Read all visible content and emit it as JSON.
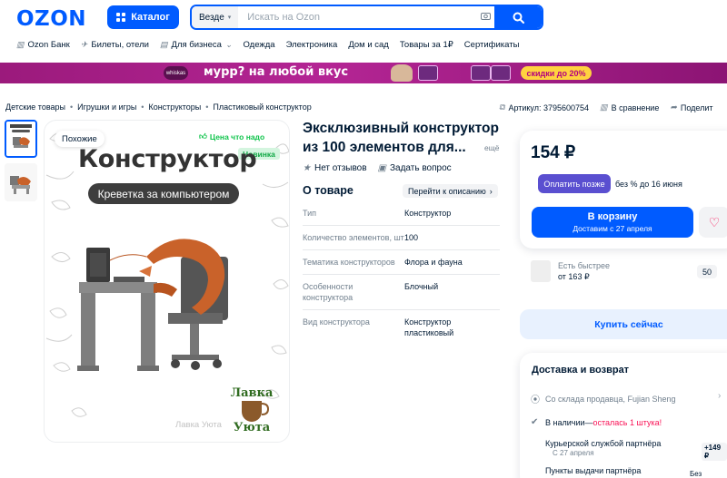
{
  "header": {
    "logo": "OZON",
    "catalog_label": "Каталог",
    "search_scope": "Везде",
    "search_placeholder": "Искать на Ozon"
  },
  "topnav": [
    {
      "label": "Ozon Банк",
      "icon": "bank-icon"
    },
    {
      "label": "Билеты, отели",
      "icon": "plane-icon"
    },
    {
      "label": "Для бизнеса",
      "icon": "briefcase-icon"
    },
    {
      "label": "Одежда"
    },
    {
      "label": "Электроника"
    },
    {
      "label": "Дом и сад"
    },
    {
      "label": "Товары за 1₽"
    },
    {
      "label": "Сертификаты"
    }
  ],
  "banner": {
    "brand": "whiskas",
    "text": "мурр? на любой вкус",
    "discount": "скидки до 20%"
  },
  "breadcrumbs": [
    "Детские товары",
    "Игрушки и игры",
    "Конструкторы",
    "Пластиковый конструктор"
  ],
  "meta": {
    "article": "Артикул: 3795600754",
    "compare": "В сравнение",
    "share": "Поделит"
  },
  "gallery": {
    "similar": "Похожие",
    "price_badge": "Цена что надо",
    "new_badge": "Новинка",
    "heading": "Конструктор",
    "subheading": "Креветка за компьютером",
    "shop_name": "Лавка Уюта",
    "logo_line1": "Лавка",
    "logo_line2": "Уюта"
  },
  "product": {
    "title": "Эксклюзивный конструктор из 100 элементов для...",
    "more": "ещё",
    "reviews": "Нет отзывов",
    "ask": "Задать вопрос",
    "about_title": "О товаре",
    "goto_description": "Перейти к описанию",
    "specs": [
      {
        "key": "Тип",
        "value": "Конструктор"
      },
      {
        "key": "Количество элементов, шт",
        "value": "100"
      },
      {
        "key": "Тематика конструкторов",
        "value": "Флора и фауна"
      },
      {
        "key": "Особенности конструктора",
        "value": "Блочный"
      },
      {
        "key": "Вид конструктора",
        "value": "Конструктор пластиковый"
      }
    ]
  },
  "buy": {
    "price": "154 ₽",
    "pay_later_button": "Оплатить позже",
    "pay_later_text": "без % до 16 июня",
    "cart_label": "В корзину",
    "cart_sub": "Доставим с 27 апреля",
    "faster_label": "Есть быстрее",
    "faster_price": "от 163 ₽",
    "faster_count": "50",
    "buy_now": "Купить сейчас"
  },
  "delivery": {
    "title": "Доставка и возврат",
    "from": "Со склада продавца, Fujian Sheng",
    "stock": "В наличии",
    "stock_sep": " — ",
    "stock_left": "осталась 1 штука!",
    "courier": "Курьерской службой партнёра",
    "courier_date": "С 27 апреля",
    "courier_price": "+149 ₽",
    "pickup": "Пункты выдачи партнёра",
    "pickup_price": "Без доплат"
  },
  "colors": {
    "brand": "#005bff",
    "success": "#10c44c",
    "danger": "#f91155",
    "pay_later": "#5a4fd0"
  }
}
